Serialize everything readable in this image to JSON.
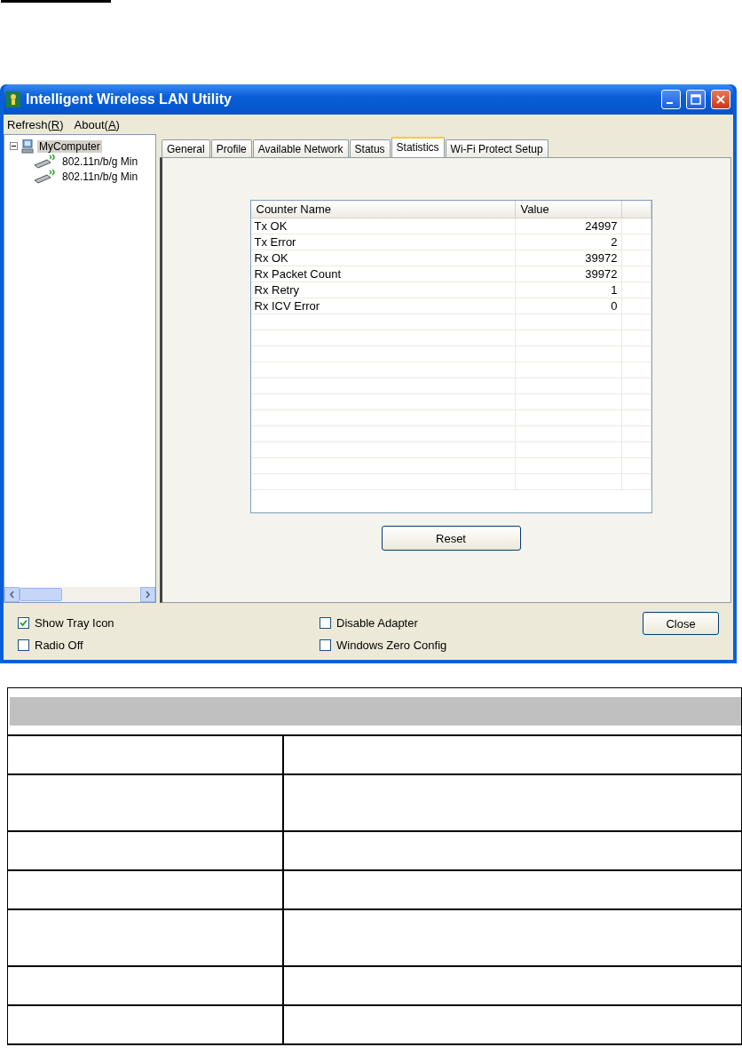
{
  "window": {
    "title": "Intelligent Wireless LAN Utility"
  },
  "menu": [
    {
      "text": "Refresh(",
      "mnemonic": "R",
      "tail": ")"
    },
    {
      "text": "About(",
      "mnemonic": "A",
      "tail": ")"
    }
  ],
  "tree": [
    {
      "label": "MyComputer",
      "expanded": true,
      "selected": true,
      "kind": "computer",
      "children": [
        {
          "label": "802.11n/b/g Min",
          "selected": false,
          "kind": "adapter"
        },
        {
          "label": "802.11n/b/g Min",
          "selected": false,
          "kind": "adapter"
        }
      ]
    }
  ],
  "tabs": [
    {
      "label": "General",
      "selected": false
    },
    {
      "label": "Profile",
      "selected": false
    },
    {
      "label": "Available Network",
      "selected": false
    },
    {
      "label": "Status",
      "selected": false
    },
    {
      "label": "Statistics",
      "selected": true
    },
    {
      "label": "Wi-Fi Protect Setup",
      "selected": false
    }
  ],
  "statistics": {
    "columns": [
      "Counter Name",
      "Value"
    ],
    "rows": [
      {
        "name": "Tx OK",
        "value": "24997"
      },
      {
        "name": "Tx Error",
        "value": "2"
      },
      {
        "name": "Rx OK",
        "value": "39972"
      },
      {
        "name": "Rx Packet Count",
        "value": "39972"
      },
      {
        "name": "Rx Retry",
        "value": "1"
      },
      {
        "name": "Rx ICV Error",
        "value": "0"
      }
    ]
  },
  "reset_button": "Reset",
  "options": [
    {
      "label": "Show Tray Icon",
      "checked": true
    },
    {
      "label": "Radio Off",
      "checked": false
    },
    {
      "label": "Disable Adapter",
      "checked": false
    },
    {
      "label": "Windows Zero Config",
      "checked": false
    }
  ],
  "close_button": "Close"
}
